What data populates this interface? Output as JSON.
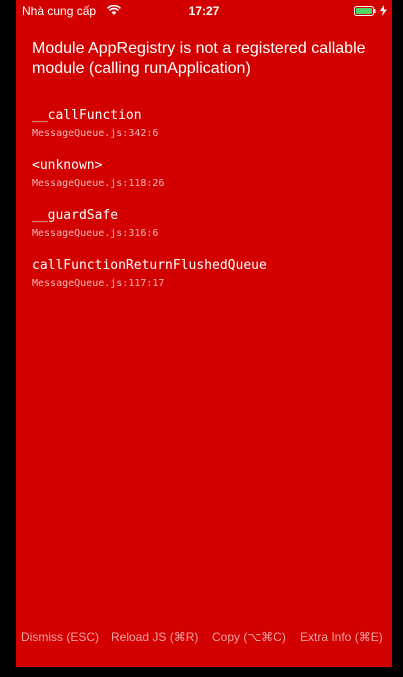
{
  "status_bar": {
    "carrier": "Nhà cung cấp",
    "time": "17:27",
    "wifi_icon": "wifi-icon",
    "battery_icon": "battery-icon",
    "battery_color": "#4cd964"
  },
  "error": {
    "title": "Module AppRegistry is not a registered callable module (calling runApplication)"
  },
  "stack": [
    {
      "name": "__callFunction",
      "location": "MessageQueue.js:342:6"
    },
    {
      "name": "<unknown>",
      "location": "MessageQueue.js:118:26"
    },
    {
      "name": "__guardSafe",
      "location": "MessageQueue.js:316:6"
    },
    {
      "name": "callFunctionReturnFlushedQueue",
      "location": "MessageQueue.js:117:17"
    }
  ],
  "footer": {
    "dismiss": "Dismiss (ESC)",
    "reload": "Reload JS (⌘R)",
    "copy": "Copy (⌥⌘C)",
    "extra": "Extra Info (⌘E)"
  },
  "colors": {
    "background": "#d30000",
    "text": "#ffffff",
    "secondary_text": "#f2b6b6"
  }
}
